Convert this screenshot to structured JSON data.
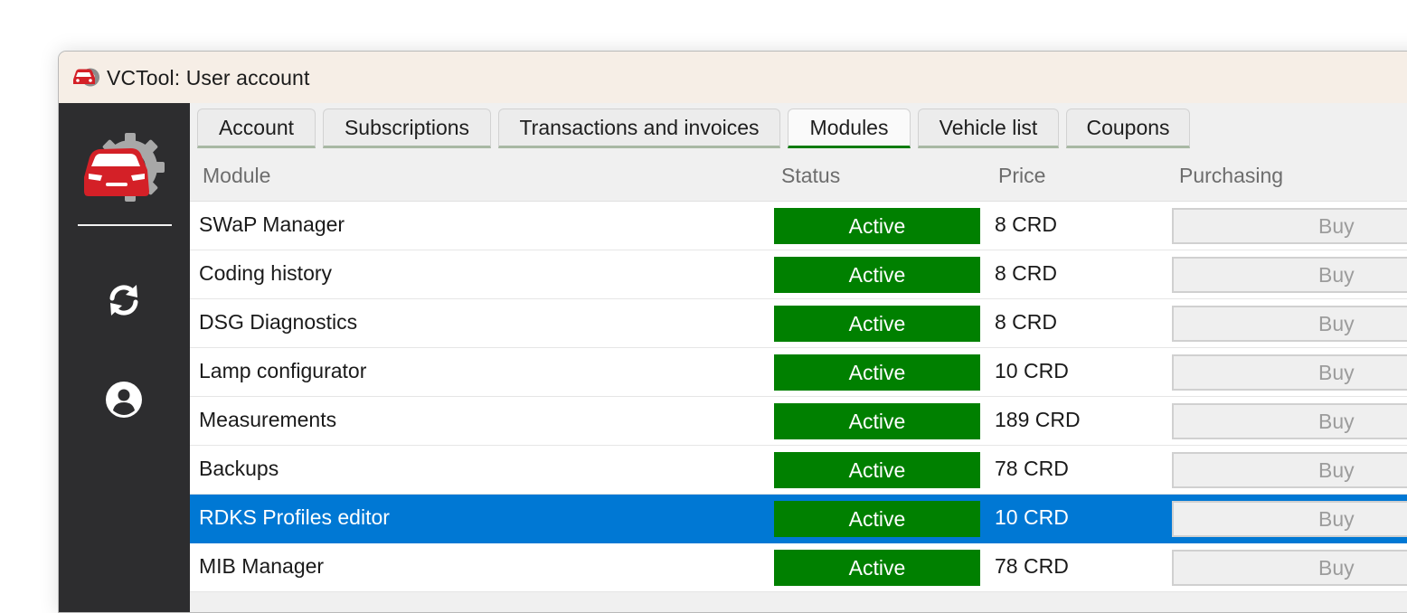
{
  "window": {
    "title": "VCTool: User account"
  },
  "sidebar": {
    "logo_icon": "car-gear-logo-icon",
    "refresh_icon": "refresh-icon",
    "account_icon": "user-circle-icon"
  },
  "tabs": [
    {
      "label": "Account"
    },
    {
      "label": "Subscriptions"
    },
    {
      "label": "Transactions and invoices"
    },
    {
      "label": "Modules",
      "active": true
    },
    {
      "label": "Vehicle list"
    },
    {
      "label": "Coupons"
    }
  ],
  "table": {
    "columns": {
      "module": "Module",
      "status": "Status",
      "price": "Price",
      "purchasing": "Purchasing"
    },
    "rows": [
      {
        "module": "SWaP Manager",
        "status": "Active",
        "price": "8 CRD",
        "action": "Buy"
      },
      {
        "module": "Coding history",
        "status": "Active",
        "price": "8 CRD",
        "action": "Buy"
      },
      {
        "module": "DSG Diagnostics",
        "status": "Active",
        "price": "8 CRD",
        "action": "Buy"
      },
      {
        "module": "Lamp configurator",
        "status": "Active",
        "price": "10 CRD",
        "action": "Buy"
      },
      {
        "module": "Measurements",
        "status": "Active",
        "price": "189 CRD",
        "action": "Buy"
      },
      {
        "module": "Backups",
        "status": "Active",
        "price": "78 CRD",
        "action": "Buy"
      },
      {
        "module": "RDKS Profiles editor",
        "status": "Active",
        "price": "10 CRD",
        "action": "Buy",
        "selected": true
      },
      {
        "module": "MIB Manager",
        "status": "Active",
        "price": "78 CRD",
        "action": "Buy"
      }
    ]
  },
  "colors": {
    "status_active": "#008000",
    "selection": "#0078d4",
    "sidebar": "#2d2d2f",
    "brand_red": "#d42027",
    "tab_active_underline": "#107c10"
  }
}
